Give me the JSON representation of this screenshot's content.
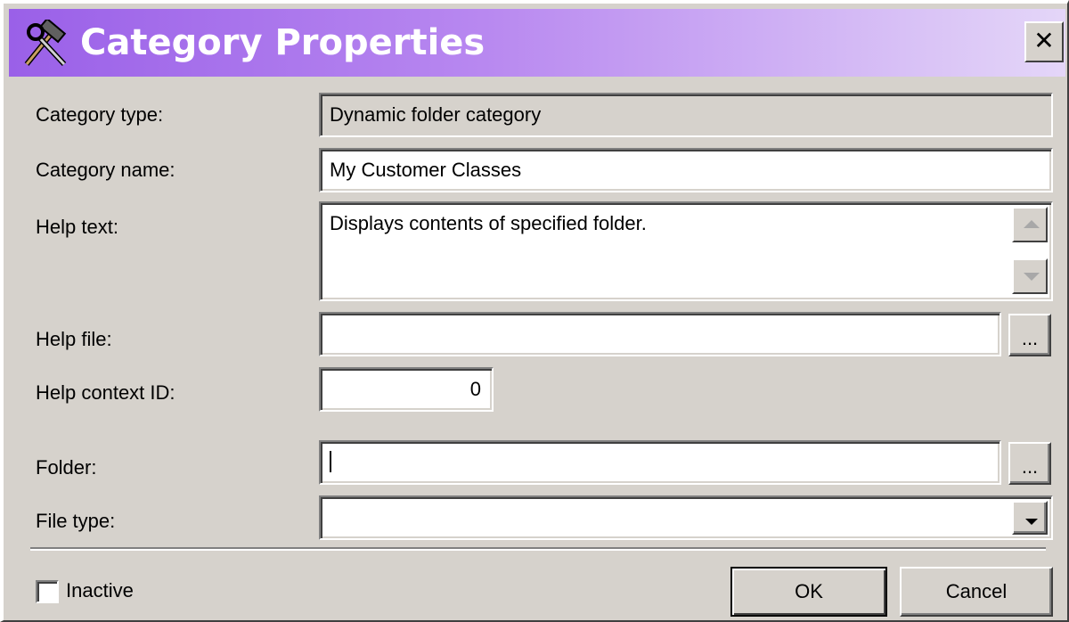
{
  "dialog": {
    "title": "Category Properties",
    "close_label": "✕"
  },
  "fields": {
    "category_type": {
      "label": "Category type:",
      "value": "Dynamic folder category"
    },
    "category_name": {
      "label": "Category name:",
      "value": "My Customer Classes"
    },
    "help_text": {
      "label": "Help text:",
      "value": "Displays contents of specified folder."
    },
    "help_file": {
      "label": "Help file:",
      "value": "",
      "browse_label": "..."
    },
    "help_context_id": {
      "label": "Help context ID:",
      "value": "0"
    },
    "folder": {
      "label": "Folder:",
      "value": "",
      "browse_label": "..."
    },
    "file_type": {
      "label": "File type:",
      "value": ""
    }
  },
  "footer": {
    "inactive_label": "Inactive",
    "inactive_checked": false,
    "ok_label": "OK",
    "cancel_label": "Cancel"
  },
  "icons": {
    "title_icon": "tools-icon",
    "close_icon": "close-icon",
    "scroll_up": "arrow-up-icon",
    "scroll_down": "arrow-down-icon",
    "dropdown": "chevron-down-icon"
  }
}
